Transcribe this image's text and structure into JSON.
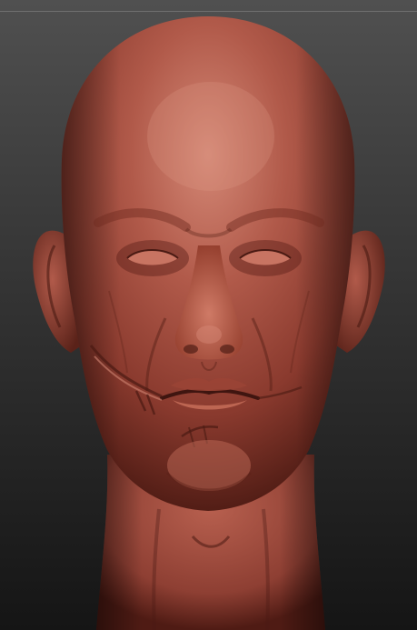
{
  "viewport": {
    "background_top": "#505050",
    "background_bottom": "#151515"
  },
  "model": {
    "material_color": "#a0463a",
    "highlight_color": "#cf7a66",
    "shadow_color": "#3f1510",
    "icon": "sculpted-head-model"
  }
}
